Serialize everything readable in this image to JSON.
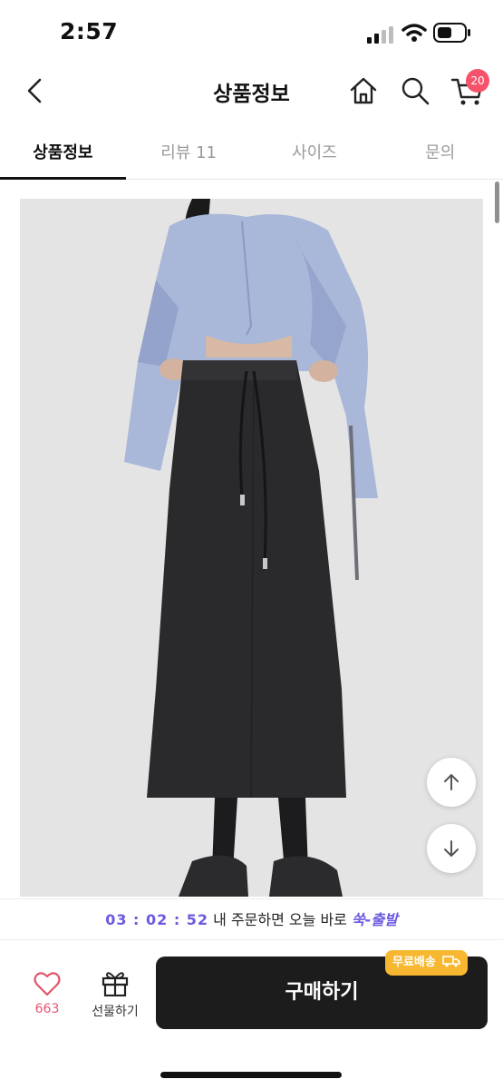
{
  "status_bar": {
    "time": "2:57"
  },
  "header": {
    "title": "상품정보",
    "cart_count": "20",
    "icons": [
      "chevron-left-icon",
      "home-icon",
      "search-icon",
      "cart-icon"
    ]
  },
  "tabs": [
    {
      "label": "상품정보",
      "active": true
    },
    {
      "label": "리뷰 11",
      "active": false
    },
    {
      "label": "사이즈",
      "active": false
    },
    {
      "label": "문의",
      "active": false
    }
  ],
  "promo": {
    "timer": "03 : 02 : 52",
    "message": " 내 주문하면 오늘 바로 ",
    "brand": "쑥-출발"
  },
  "bottom_bar": {
    "like_count": "663",
    "gift_label": "선물하기",
    "buy_label": "구매하기",
    "free_shipping_badge": "무료배송"
  },
  "colors": {
    "accent_purple": "#6a5ae0",
    "badge_pink": "#f4536b",
    "free_ship_yellow": "#f7b731",
    "buy_button": "#1c1c1c"
  }
}
